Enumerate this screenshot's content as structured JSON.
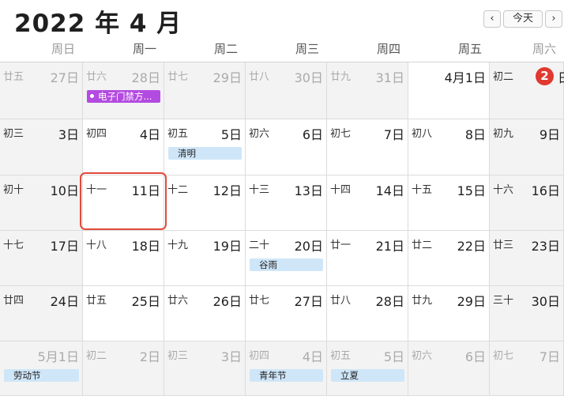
{
  "header": {
    "title": "2022 年 4 月"
  },
  "nav": {
    "prev": "‹",
    "today": "今天",
    "next": "›"
  },
  "weekdays": [
    "周日",
    "周一",
    "周二",
    "周三",
    "周四",
    "周五",
    "周六"
  ],
  "weeks": [
    [
      {
        "lunar": "廿五",
        "solar": "27日",
        "dim": true
      },
      {
        "lunar": "廿六",
        "solar": "28日",
        "dim": true,
        "event": "电子门禁方...",
        "event_color": "#b34be0"
      },
      {
        "lunar": "廿七",
        "solar": "29日",
        "dim": true
      },
      {
        "lunar": "廿八",
        "solar": "30日",
        "dim": true
      },
      {
        "lunar": "廿九",
        "solar": "31日",
        "dim": true
      },
      {
        "lunar": "",
        "solar": "4月1日",
        "dim": false
      },
      {
        "lunar": "初二",
        "solar": "2",
        "solar_suffix": "日",
        "today": true
      }
    ],
    [
      {
        "lunar": "初三",
        "solar": "3日"
      },
      {
        "lunar": "初四",
        "solar": "4日"
      },
      {
        "lunar": "初五",
        "solar": "5日",
        "event": "清明"
      },
      {
        "lunar": "初六",
        "solar": "6日"
      },
      {
        "lunar": "初七",
        "solar": "7日"
      },
      {
        "lunar": "初八",
        "solar": "8日"
      },
      {
        "lunar": "初九",
        "solar": "9日"
      }
    ],
    [
      {
        "lunar": "初十",
        "solar": "10日"
      },
      {
        "lunar": "十一",
        "solar": "11日",
        "selected": true
      },
      {
        "lunar": "十二",
        "solar": "12日"
      },
      {
        "lunar": "十三",
        "solar": "13日"
      },
      {
        "lunar": "十四",
        "solar": "14日"
      },
      {
        "lunar": "十五",
        "solar": "15日"
      },
      {
        "lunar": "十六",
        "solar": "16日"
      }
    ],
    [
      {
        "lunar": "十七",
        "solar": "17日"
      },
      {
        "lunar": "十八",
        "solar": "18日"
      },
      {
        "lunar": "十九",
        "solar": "19日"
      },
      {
        "lunar": "二十",
        "solar": "20日",
        "event": "谷雨"
      },
      {
        "lunar": "廿一",
        "solar": "21日"
      },
      {
        "lunar": "廿二",
        "solar": "22日"
      },
      {
        "lunar": "廿三",
        "solar": "23日"
      }
    ],
    [
      {
        "lunar": "廿四",
        "solar": "24日"
      },
      {
        "lunar": "廿五",
        "solar": "25日"
      },
      {
        "lunar": "廿六",
        "solar": "26日"
      },
      {
        "lunar": "廿七",
        "solar": "27日"
      },
      {
        "lunar": "廿八",
        "solar": "28日"
      },
      {
        "lunar": "廿九",
        "solar": "29日"
      },
      {
        "lunar": "三十",
        "solar": "30日"
      }
    ],
    [
      {
        "lunar": "",
        "solar": "5月1日",
        "dim": true,
        "event": "劳动节"
      },
      {
        "lunar": "初二",
        "solar": "2日",
        "dim": true
      },
      {
        "lunar": "初三",
        "solar": "3日",
        "dim": true
      },
      {
        "lunar": "初四",
        "solar": "4日",
        "dim": true,
        "event": "青年节"
      },
      {
        "lunar": "初五",
        "solar": "5日",
        "dim": true,
        "event": "立夏"
      },
      {
        "lunar": "初六",
        "solar": "6日",
        "dim": true
      },
      {
        "lunar": "初七",
        "solar": "7日",
        "dim": true
      }
    ]
  ]
}
